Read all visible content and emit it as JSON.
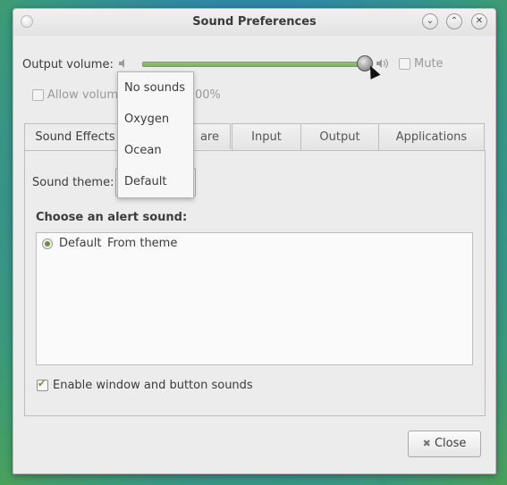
{
  "window": {
    "title": "Sound Preferences"
  },
  "output": {
    "label": "Output volume:",
    "mute_label": "Mute",
    "allow_label_visible": "Allow volum",
    "allow_label_tail": "00%",
    "volume_level_percent": 96
  },
  "tabs": [
    {
      "label": "Sound Effects"
    },
    {
      "label": "are"
    },
    {
      "label": "Input"
    },
    {
      "label": "Output"
    },
    {
      "label": "Applications"
    }
  ],
  "sound_effects": {
    "theme_label": "Sound theme:",
    "alert_heading": "Choose an alert sound:",
    "alert_items": [
      {
        "name": "Default",
        "source": "From theme"
      }
    ],
    "enable_sounds_label": "Enable window and button sounds"
  },
  "theme_menu": {
    "options": [
      "No sounds",
      "Oxygen",
      "Ocean",
      "Default"
    ]
  },
  "footer": {
    "close_label": "Close"
  },
  "colors": {
    "accent": "#6a8f3c",
    "slider": "#8fb86f"
  }
}
